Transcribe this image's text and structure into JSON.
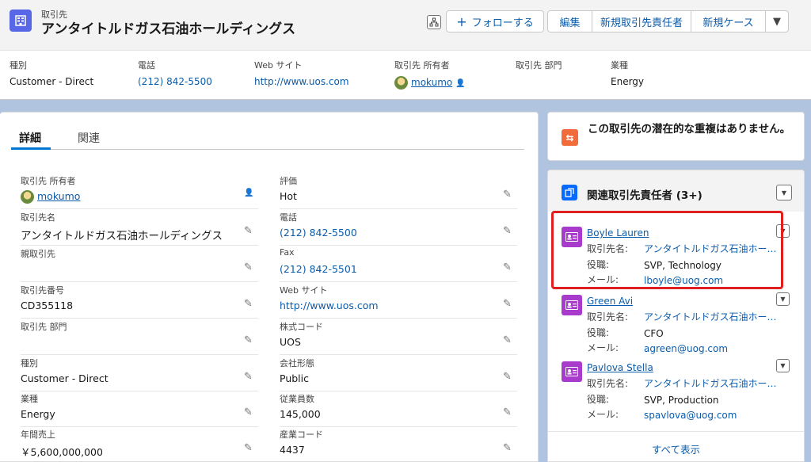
{
  "header": {
    "object_label": "取引先",
    "title": "アンタイトルドガス石油ホールディングス",
    "buttons": {
      "follow": "フォローする",
      "edit": "編集",
      "new_contact": "新規取引先責任者",
      "new_case": "新規ケース"
    },
    "fields": [
      {
        "label": "種別",
        "value": "Customer - Direct"
      },
      {
        "label": "電話",
        "value": "(212) 842-5500"
      },
      {
        "label": "Web サイト",
        "value": "http://www.uos.com"
      },
      {
        "label": "取引先 所有者",
        "value": "mokumo"
      },
      {
        "label": "取引先 部門",
        "value": ""
      },
      {
        "label": "業種",
        "value": "Energy"
      }
    ]
  },
  "tabs": {
    "details": "詳細",
    "related": "関連"
  },
  "details": {
    "left": [
      {
        "label": "取引先 所有者",
        "value": "mokumo"
      },
      {
        "label": "取引先名",
        "value": "アンタイトルドガス石油ホールディングス"
      },
      {
        "label": "親取引先",
        "value": ""
      },
      {
        "label": "取引先番号",
        "value": "CD355118"
      },
      {
        "label": "取引先 部門",
        "value": ""
      },
      {
        "label": "種別",
        "value": "Customer - Direct"
      },
      {
        "label": "業種",
        "value": "Energy"
      },
      {
        "label": "年間売上",
        "value": "￥5,600,000,000"
      }
    ],
    "right": [
      {
        "label": "評価",
        "value": "Hot"
      },
      {
        "label": "電話",
        "value": "(212) 842-5500"
      },
      {
        "label": "Fax",
        "value": "(212) 842-5501"
      },
      {
        "label": "Web サイト",
        "value": "http://www.uos.com"
      },
      {
        "label": "株式コード",
        "value": "UOS"
      },
      {
        "label": "会社形態",
        "value": "Public"
      },
      {
        "label": "従業員数",
        "value": "145,000"
      },
      {
        "label": "産業コード",
        "value": "4437"
      }
    ]
  },
  "duplicates": {
    "text": "この取引先の潜在的な重複はありません。"
  },
  "related_contacts": {
    "title": "関連取引先責任者 (3+)",
    "labels": {
      "account": "取引先名:",
      "role": "役職:",
      "email": "メール:"
    },
    "items": [
      {
        "name": "Boyle Lauren",
        "account": "アンタイトルドガス石油ホールディングス",
        "role": "SVP, Technology",
        "email": "lboyle@uog.com"
      },
      {
        "name": "Green Avi",
        "account": "アンタイトルドガス石油ホールディングス",
        "role": "CFO",
        "email": "agreen@uog.com"
      },
      {
        "name": "Pavlova Stella",
        "account": "アンタイトルドガス石油ホールディングス",
        "role": "SVP, Production",
        "email": "spavlova@uog.com"
      }
    ],
    "view_all": "すべて表示"
  }
}
